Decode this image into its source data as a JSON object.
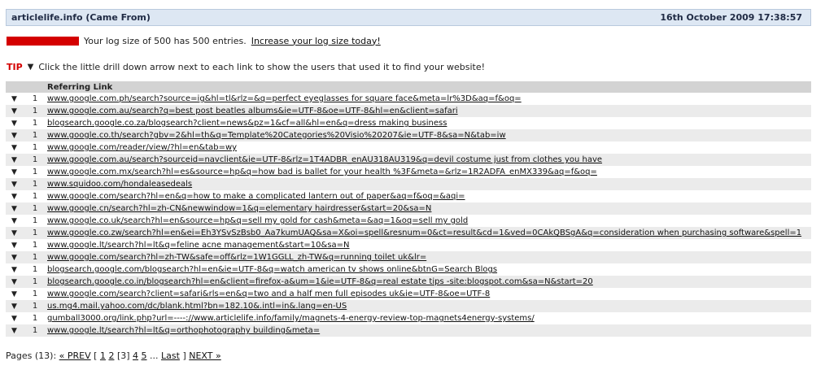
{
  "header": {
    "title": "articlelife.info (Came From)",
    "date": "16th October 2009 17:38:57"
  },
  "log": {
    "message": "Your log size of 500 has 500 entries.",
    "link": "Increase your log size today!",
    "meter_color": "#d40000",
    "meter_fill": 1.0
  },
  "tip": {
    "label": "TIP",
    "arrow": "▼",
    "text": "Click the little drill down arrow next to each link to show the users that used it to find your website!"
  },
  "table": {
    "header_link": "Referring Link",
    "arrow": "▼",
    "rows": [
      {
        "count": "1",
        "link": "www.google.com.ph/search?source=ig&hl=tl&rlz=&q=perfect eyeglasses for square face&meta=lr%3D&aq=f&oq="
      },
      {
        "count": "1",
        "link": "www.google.com.au/search?q=best post beatles albums&ie=UTF-8&oe=UTF-8&hl=en&client=safari"
      },
      {
        "count": "1",
        "link": "blogsearch.google.co.za/blogsearch?client=news&pz=1&cf=all&hl=en&q=dress making business"
      },
      {
        "count": "1",
        "link": "www.google.co.th/search?gbv=2&hl=th&q=Template%20Categories%20Visio%20207&ie=UTF-8&sa=N&tab=iw"
      },
      {
        "count": "1",
        "link": "www.google.com/reader/view/?hl=en&tab=wy"
      },
      {
        "count": "1",
        "link": "www.google.com.au/search?sourceid=navclient&ie=UTF-8&rlz=1T4ADBR_enAU318AU319&q=devil costume just from clothes you have"
      },
      {
        "count": "1",
        "link": "www.google.com.mx/search?hl=es&source=hp&q=how bad is ballet for your health %3F&meta=&rlz=1R2ADFA_enMX339&aq=f&oq="
      },
      {
        "count": "1",
        "link": "www.squidoo.com/hondaleasedeals"
      },
      {
        "count": "1",
        "link": "www.google.com/search?hl=en&q=how to make a complicated lantern out of paper&aq=f&oq=&aqi="
      },
      {
        "count": "1",
        "link": "www.google.cn/search?hl=zh-CN&newwindow=1&q=elementary hairdresser&start=20&sa=N"
      },
      {
        "count": "1",
        "link": "www.google.co.uk/search?hl=en&source=hp&q=sell my gold for cash&meta=&aq=1&oq=sell my gold"
      },
      {
        "count": "1",
        "link": "www.google.co.zw/search?hl=en&ei=Eh3YSvSzBsb0_Aa7kumUAQ&sa=X&oi=spell&resnum=0&ct=result&cd=1&ved=0CAkQBSgA&q=consideration when purchasing software&spell=1"
      },
      {
        "count": "1",
        "link": "www.google.lt/search?hl=lt&q=feline acne management&start=10&sa=N"
      },
      {
        "count": "1",
        "link": "www.google.com/search?hl=zh-TW&safe=off&rlz=1W1GGLL_zh-TW&q=running toilet uk&lr="
      },
      {
        "count": "1",
        "link": "blogsearch.google.com/blogsearch?hl=en&ie=UTF-8&q=watch american tv shows online&btnG=Search Blogs"
      },
      {
        "count": "1",
        "link": "blogsearch.google.co.in/blogsearch?hl=en&client=firefox-a&um=1&ie=UTF-8&q=real estate tips -site:blogspot.com&sa=N&start=20"
      },
      {
        "count": "1",
        "link": "www.google.com/search?client=safari&rls=en&q=two and a half men full episodes uk&ie=UTF-8&oe=UTF-8"
      },
      {
        "count": "1",
        "link": "us.mg4.mail.yahoo.com/dc/blank.html?bn=182.10&.intl=in&.lang=en-US"
      },
      {
        "count": "1",
        "link": "gumball3000.org/link.php?url=----://www.articlelife.info/family/magnets-4-energy-review-top-magnets4energy-systems/"
      },
      {
        "count": "1",
        "link": "www.google.lt/search?hl=lt&q=orthophotography building&meta="
      }
    ]
  },
  "pager": {
    "label": "Pages (13):",
    "prev": "« PREV",
    "open_bracket": "[",
    "pages": [
      "1",
      "2"
    ],
    "current": "[3]",
    "pages_after": [
      "4",
      "5"
    ],
    "ellipsis": "...",
    "last": "Last",
    "close_bracket": "]",
    "next": "NEXT »"
  }
}
